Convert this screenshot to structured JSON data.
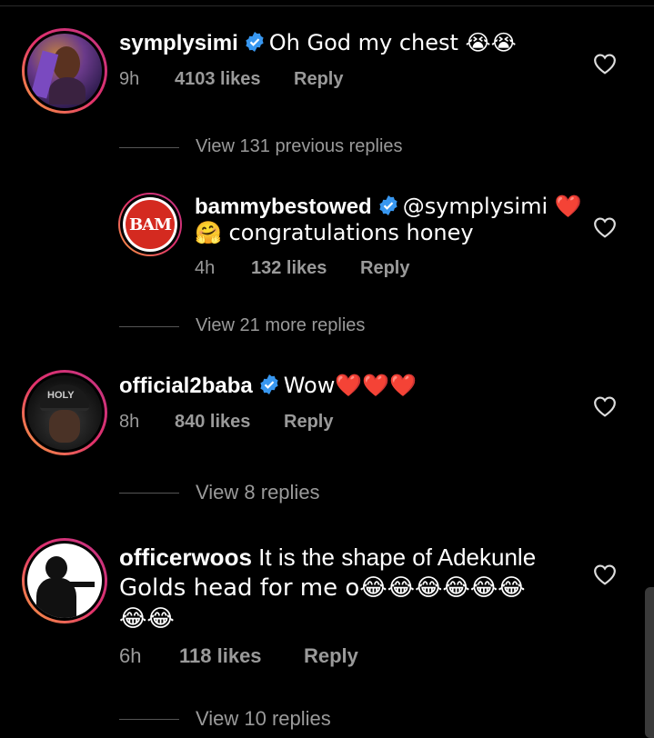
{
  "comments": [
    {
      "username": "symplysimi",
      "text": "Oh God my chest 😭😭",
      "time": "9h",
      "likes": "4103 likes",
      "reply": "Reply",
      "view_replies": "View 131 previous replies"
    },
    {
      "username": "bammybestowed",
      "avatar_text": "BAM",
      "text_line1": "@symplysimi ❤️",
      "text_line2": "🤗 congratulations honey",
      "time": "4h",
      "likes": "132 likes",
      "reply": "Reply",
      "view_replies": "View 21 more replies"
    },
    {
      "username": "official2baba",
      "avatar_text": "HOLY",
      "text": "Wow❤️❤️❤️",
      "time": "8h",
      "likes": "840 likes",
      "reply": "Reply",
      "view_replies": "View 8 replies"
    },
    {
      "username": "officerwoos",
      "text_line1": "It is the shape of Adekunle",
      "text_line2": "Golds head for me o😂😂😂😂😂😂",
      "text_line3": "😂😂",
      "time": "6h",
      "likes": "118 likes",
      "reply": "Reply",
      "view_replies": "View 10 replies"
    }
  ],
  "colors": {
    "background": "#000000",
    "meta": "#9a9a9a",
    "verified": "#3897f0",
    "bam": "#d42a20"
  },
  "icons": [
    "verified-badge-icon",
    "like-heart-icon"
  ]
}
